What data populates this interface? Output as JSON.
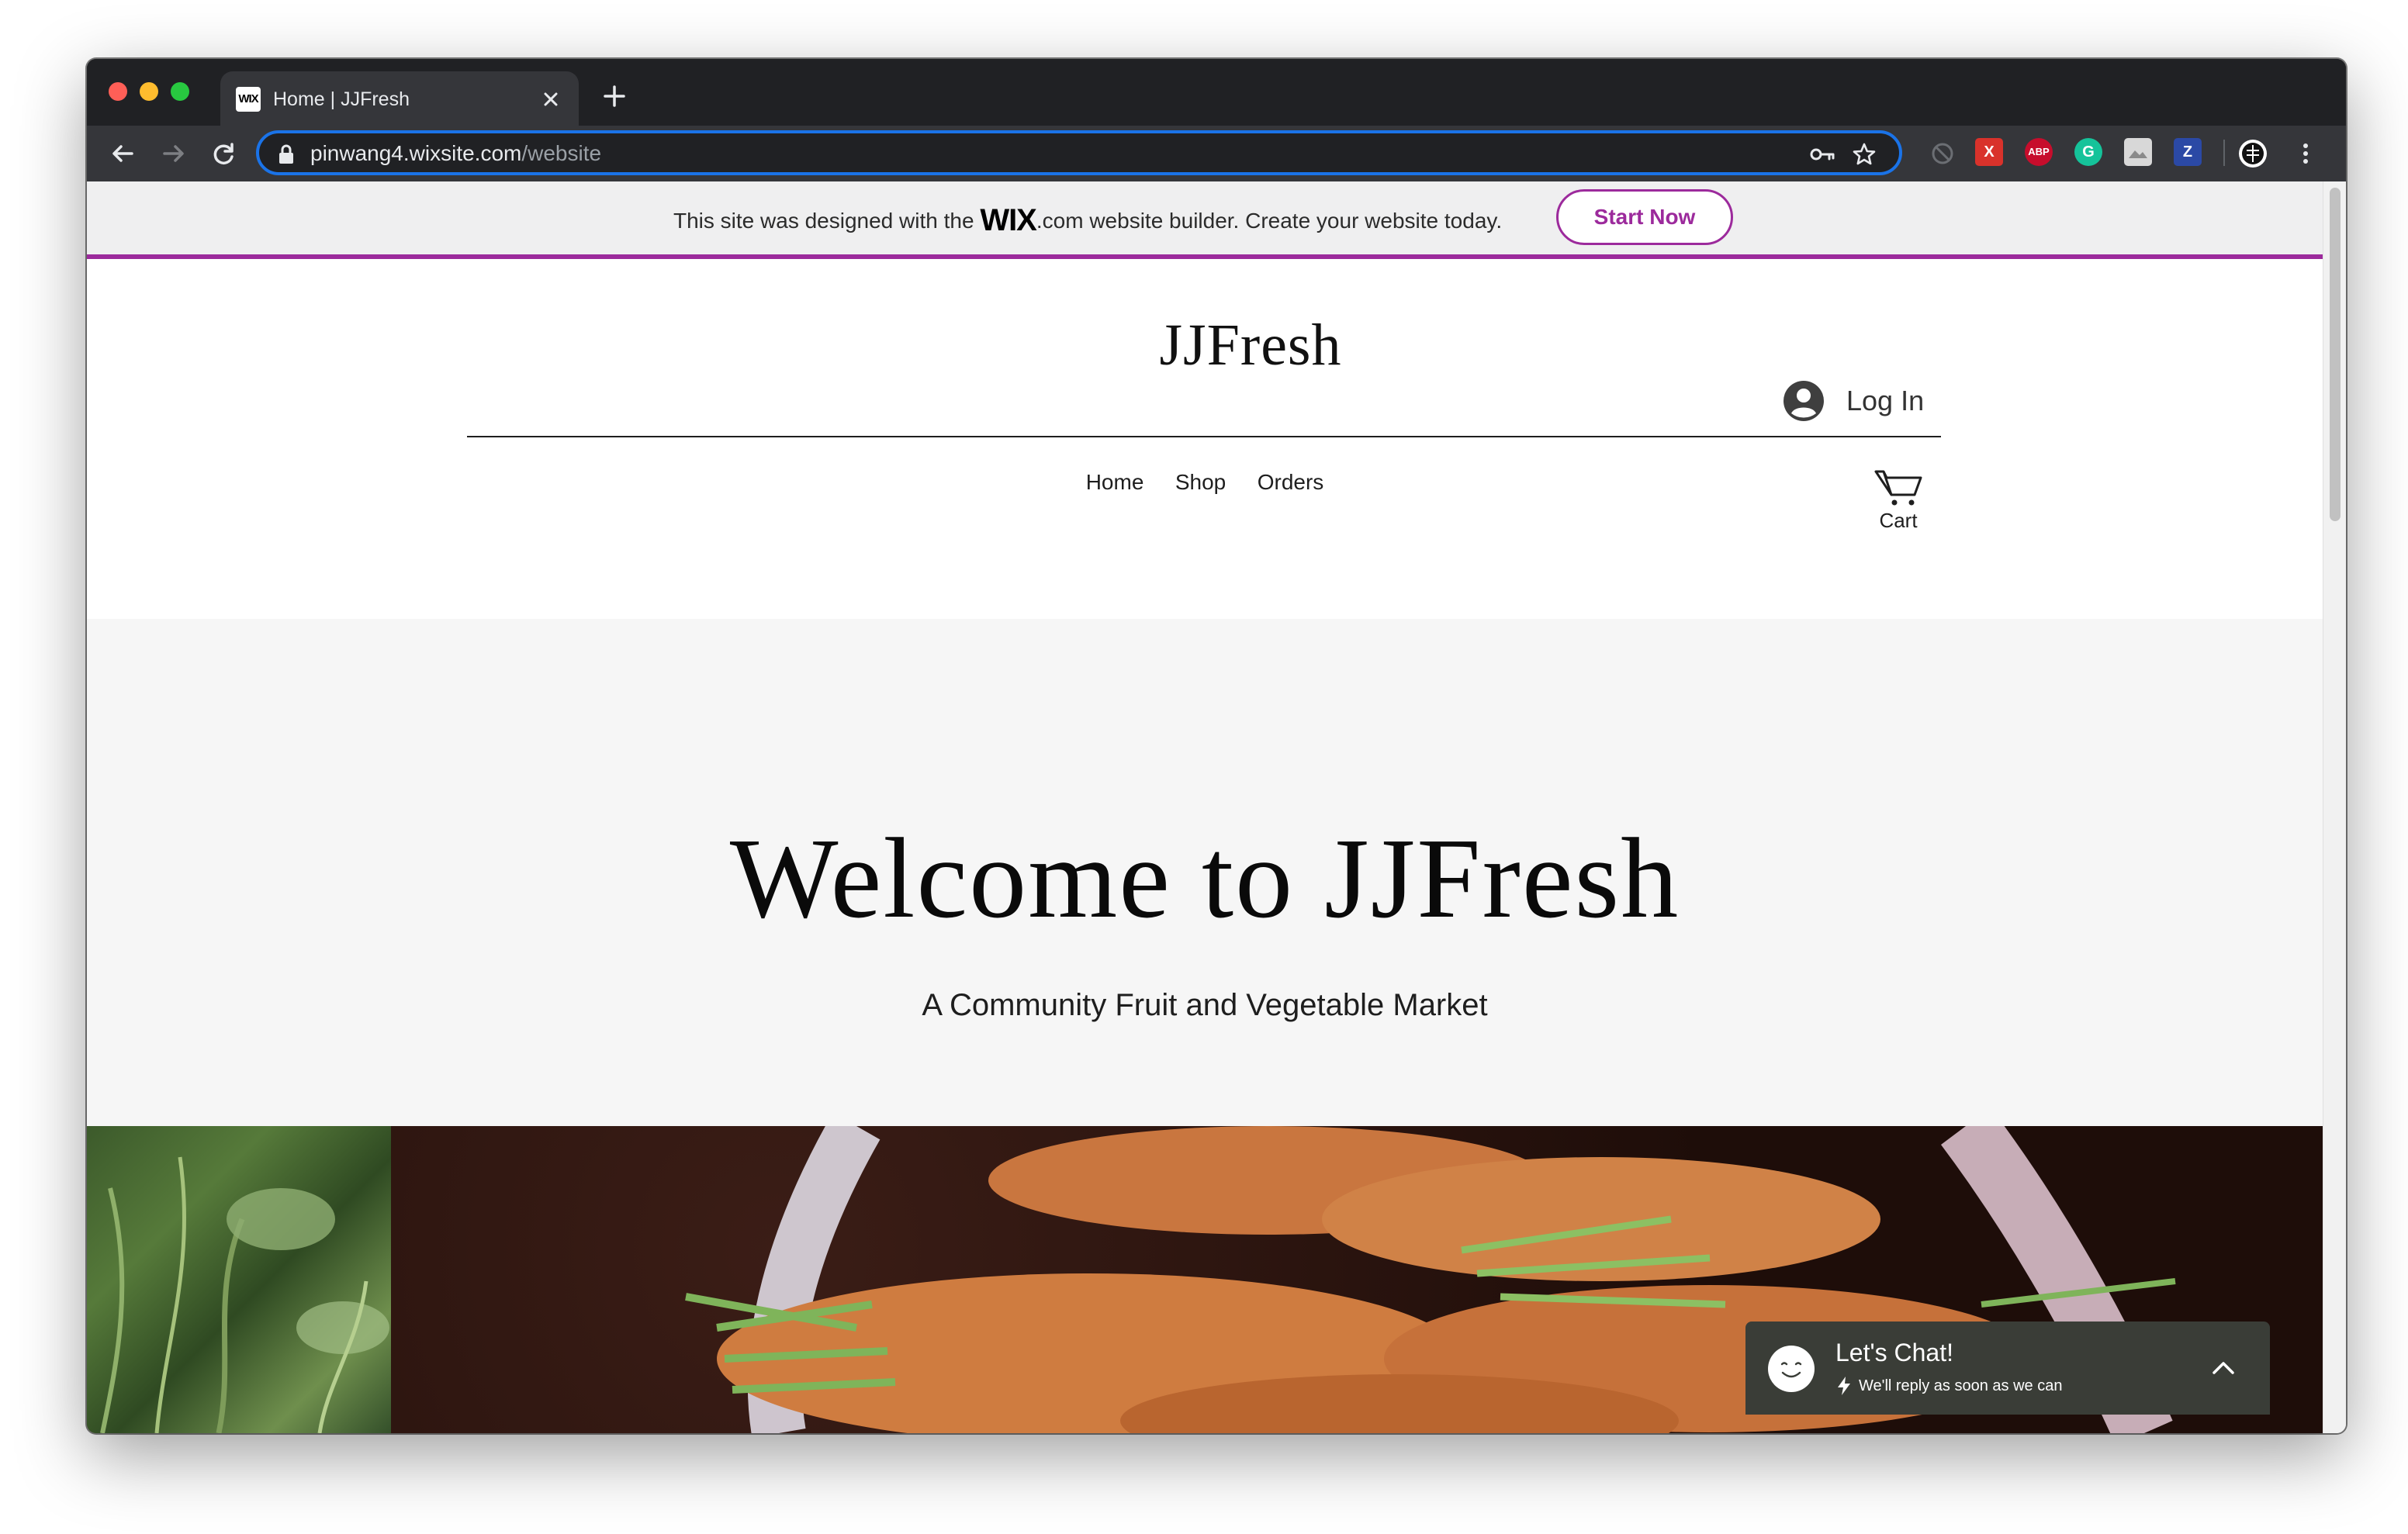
{
  "browser": {
    "tab_title": "Home | JJFresh",
    "favicon_text": "WIX",
    "url_host": "pinwang4.wixsite.com",
    "url_path": "/website",
    "extensions": [
      {
        "name": "x-extension",
        "label": "X",
        "color": "#d9322b"
      },
      {
        "name": "adblock-plus",
        "label": "ABP",
        "color": "#c70d2c"
      },
      {
        "name": "grammarly",
        "label": "G",
        "color": "#15c39a"
      },
      {
        "name": "zotero",
        "label": "Z",
        "color": "#2b49a5"
      }
    ]
  },
  "wix_banner": {
    "text_before": "This site was designed with the ",
    "logo": "WIX",
    "dotcom": ".com",
    "text_after": " website builder. Create your website today.",
    "cta": "Start Now",
    "accent": "#9c2a9c"
  },
  "header": {
    "logo": "JJFresh",
    "login": "Log In",
    "nav": [
      "Home",
      "Shop",
      "Orders"
    ],
    "cart": "Cart"
  },
  "hero": {
    "title": "Welcome to JJFresh",
    "subtitle": "A Community Fruit and Vegetable Market",
    "background": "#f6f6f6"
  },
  "chat": {
    "title": "Let's Chat!",
    "subtitle": "We'll reply as soon as we can",
    "background": "#3a3d37"
  }
}
